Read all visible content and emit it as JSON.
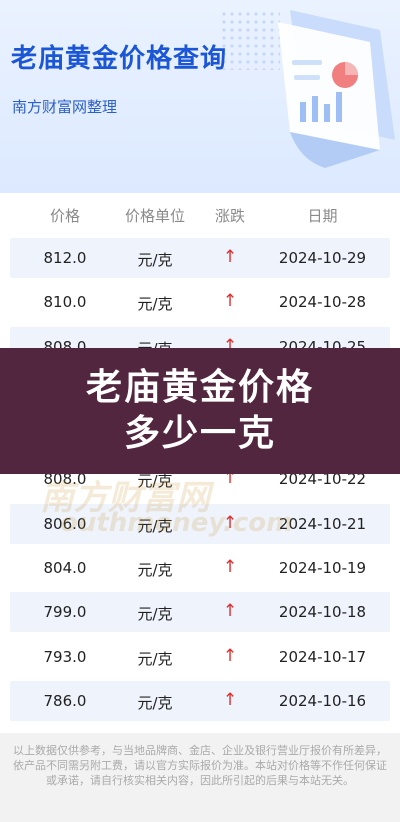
{
  "header": {
    "title": "老庙黄金价格查询",
    "subtitle": "南方财富网整理"
  },
  "table": {
    "columns": [
      "价格",
      "价格单位",
      "涨跌",
      "日期"
    ],
    "rows": [
      {
        "price": "812.0",
        "unit": "元/克",
        "trend": "↑",
        "date": "2024-10-29"
      },
      {
        "price": "810.0",
        "unit": "元/克",
        "trend": "↑",
        "date": "2024-10-28"
      },
      {
        "price": "808.0",
        "unit": "元/克",
        "trend": "↑",
        "date": "2024-10-25"
      },
      {
        "price": "",
        "unit": "",
        "trend": "",
        "date": ""
      },
      {
        "price": "",
        "unit": "",
        "trend": "",
        "date": ""
      },
      {
        "price": "808.0",
        "unit": "元/克",
        "trend": "↑",
        "date": "2024-10-22"
      },
      {
        "price": "806.0",
        "unit": "元/克",
        "trend": "↑",
        "date": "2024-10-21"
      },
      {
        "price": "804.0",
        "unit": "元/克",
        "trend": "↑",
        "date": "2024-10-19"
      },
      {
        "price": "799.0",
        "unit": "元/克",
        "trend": "↑",
        "date": "2024-10-18"
      },
      {
        "price": "793.0",
        "unit": "元/克",
        "trend": "↑",
        "date": "2024-10-17"
      },
      {
        "price": "786.0",
        "unit": "元/克",
        "trend": "↑",
        "date": "2024-10-16"
      }
    ]
  },
  "watermark": {
    "line1": "南方财富网",
    "line2": "outhmoney.com"
  },
  "overlay": {
    "text": "老庙黄金价格多少一克"
  },
  "footer": {
    "disclaimer": "以上数据仅供参考，与当地品牌商、金店、企业及银行营业厅报价有所差异，依产品不同需另附工费，请以官方实际报价为准。本站对价格等不作任何保证或承诺，请自行核实相关内容，因此所引起的后果与本站无关。"
  },
  "colors": {
    "accent": "#1a56d6",
    "up": "#e03030",
    "overlay": "#53263f"
  }
}
